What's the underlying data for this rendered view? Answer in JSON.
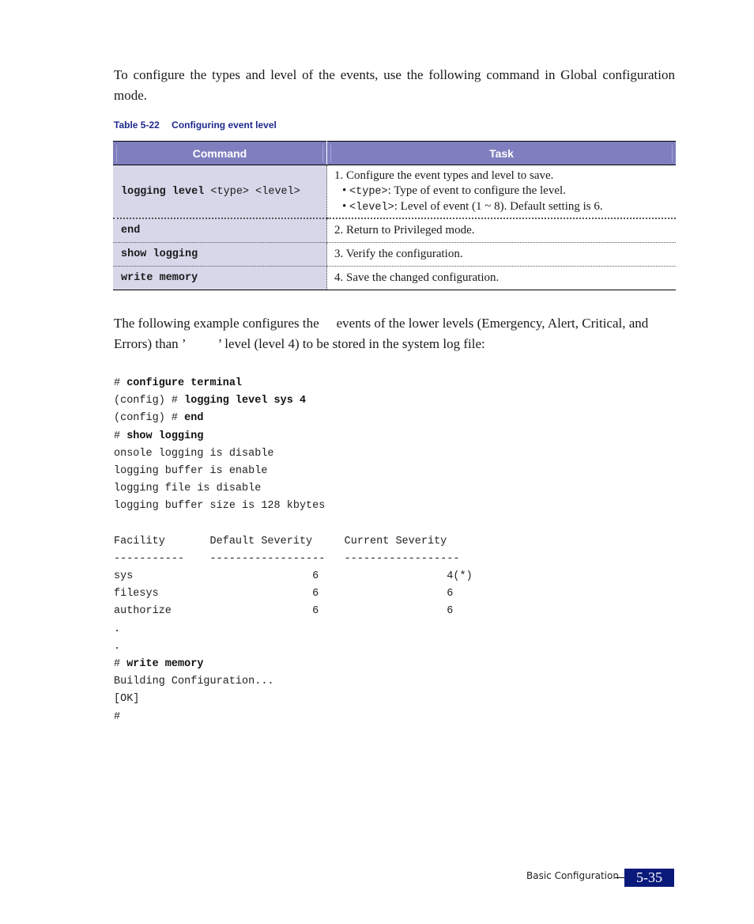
{
  "intro_text": "To configure the types and level of the events, use the following command in Global configuration mode.",
  "table": {
    "caption_number": "Table 5-22",
    "caption_title": "Configuring event level",
    "headers": [
      "Command",
      "Task"
    ],
    "rows": [
      {
        "command_bold": "logging level",
        "command_args": " <type> <level>",
        "task": "1. Configure the event types and level to save.",
        "bullets": [
          {
            "code": "<type>",
            "text": ": Type of event to configure the level."
          },
          {
            "code": "<level>",
            "text": ": Level of event (1 ~ 8). Default setting is 6."
          }
        ]
      },
      {
        "command_bold": "end",
        "task": "2. Return to Privileged mode."
      },
      {
        "command_bold": "show logging",
        "task": "3. Verify the configuration."
      },
      {
        "command_bold": "write memory",
        "task": "4. Save the changed configuration."
      }
    ]
  },
  "example_text": {
    "part1": "The following example configures the",
    "part2": "events of the lower levels (Emergency, Alert, Critical, and Errors) than ’",
    "part3": "’ level (level 4) to be stored in the system log file:"
  },
  "code": {
    "lines": [
      {
        "prefix": "# ",
        "bold": "configure terminal"
      },
      {
        "prefix": "(config) # ",
        "bold": "logging level sys 4"
      },
      {
        "prefix": "(config) # ",
        "bold": "end"
      },
      {
        "prefix": "# ",
        "bold": "show logging"
      },
      {
        "prefix": "onsole logging is disable",
        "bold": ""
      },
      {
        "prefix": "logging buffer is enable",
        "bold": ""
      },
      {
        "prefix": "logging file is disable",
        "bold": ""
      },
      {
        "prefix": "logging buffer size is 128 kbytes",
        "bold": ""
      }
    ],
    "facility_header": "Facility       Default Severity     Current Severity",
    "facility_sep": "-----------    ------------------   ------------------",
    "facility_rows": [
      "sys                            6                    4(*)",
      "filesys                        6                    6",
      "authorize                      6                    6"
    ],
    "tail_lines": [
      {
        "prefix": ".",
        "bold": ""
      },
      {
        "prefix": ".",
        "bold": ""
      },
      {
        "prefix": "# ",
        "bold": "write memory"
      },
      {
        "prefix": "Building Configuration...",
        "bold": ""
      },
      {
        "prefix": "[OK]",
        "bold": ""
      },
      {
        "prefix": "#",
        "bold": ""
      }
    ]
  },
  "footer": {
    "section": "Basic Configuration",
    "page_number": "5-35",
    "page_color": "#0a1a7a"
  }
}
